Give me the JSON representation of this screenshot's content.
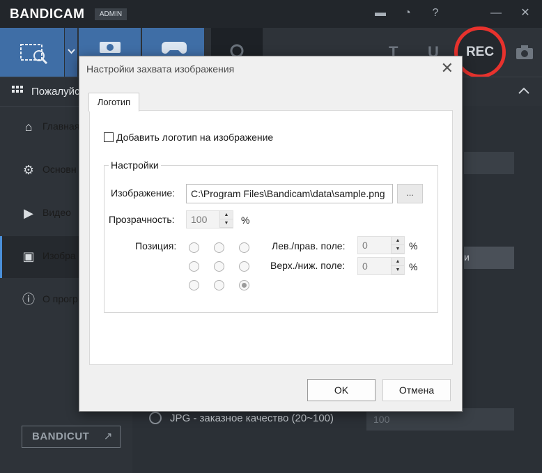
{
  "app": {
    "logo": "BANDICAM",
    "admin_badge": "ADMIN",
    "titlebar_icons": [
      "folder-icon",
      "clock-icon",
      "help-icon",
      "minimize-icon",
      "close-icon"
    ],
    "rec_label": "REC",
    "toolbar_letters": [
      "T",
      "U"
    ]
  },
  "section": {
    "title": "Пожалуйс"
  },
  "sidebar": {
    "items": [
      {
        "label": "Главная",
        "icon": "home-icon"
      },
      {
        "label": "Основн",
        "icon": "gear-icon"
      },
      {
        "label": "Видео",
        "icon": "video-settings-icon"
      },
      {
        "label": "Изобра",
        "icon": "image-settings-icon",
        "active": true
      },
      {
        "label": "О прогр",
        "icon": "info-icon"
      }
    ],
    "bandicut_label": "BANDICUT"
  },
  "background": {
    "jpg_option": "JPG - заказное качество (20~100)",
    "jpg_value": "100",
    "partial_button": "и"
  },
  "dialog": {
    "title": "Настройки захвата изображения",
    "tab_label": "Логотип",
    "add_logo_label": "Добавить логотип на изображение",
    "add_logo_checked": false,
    "group_label": "Настройки",
    "image_label": "Изображение:",
    "image_path": "C:\\Program Files\\Bandicam\\data\\sample.png",
    "browse_label": "...",
    "transparency_label": "Прозрачность:",
    "transparency_value": "100",
    "percent": "%",
    "position_label": "Позиция:",
    "position_selected": 8,
    "lr_margin_label": "Лев./прав. поле:",
    "lr_margin_value": "0",
    "tb_margin_label": "Верх./ниж. поле:",
    "tb_margin_value": "0",
    "ok_label": "OK",
    "cancel_label": "Отмена"
  }
}
